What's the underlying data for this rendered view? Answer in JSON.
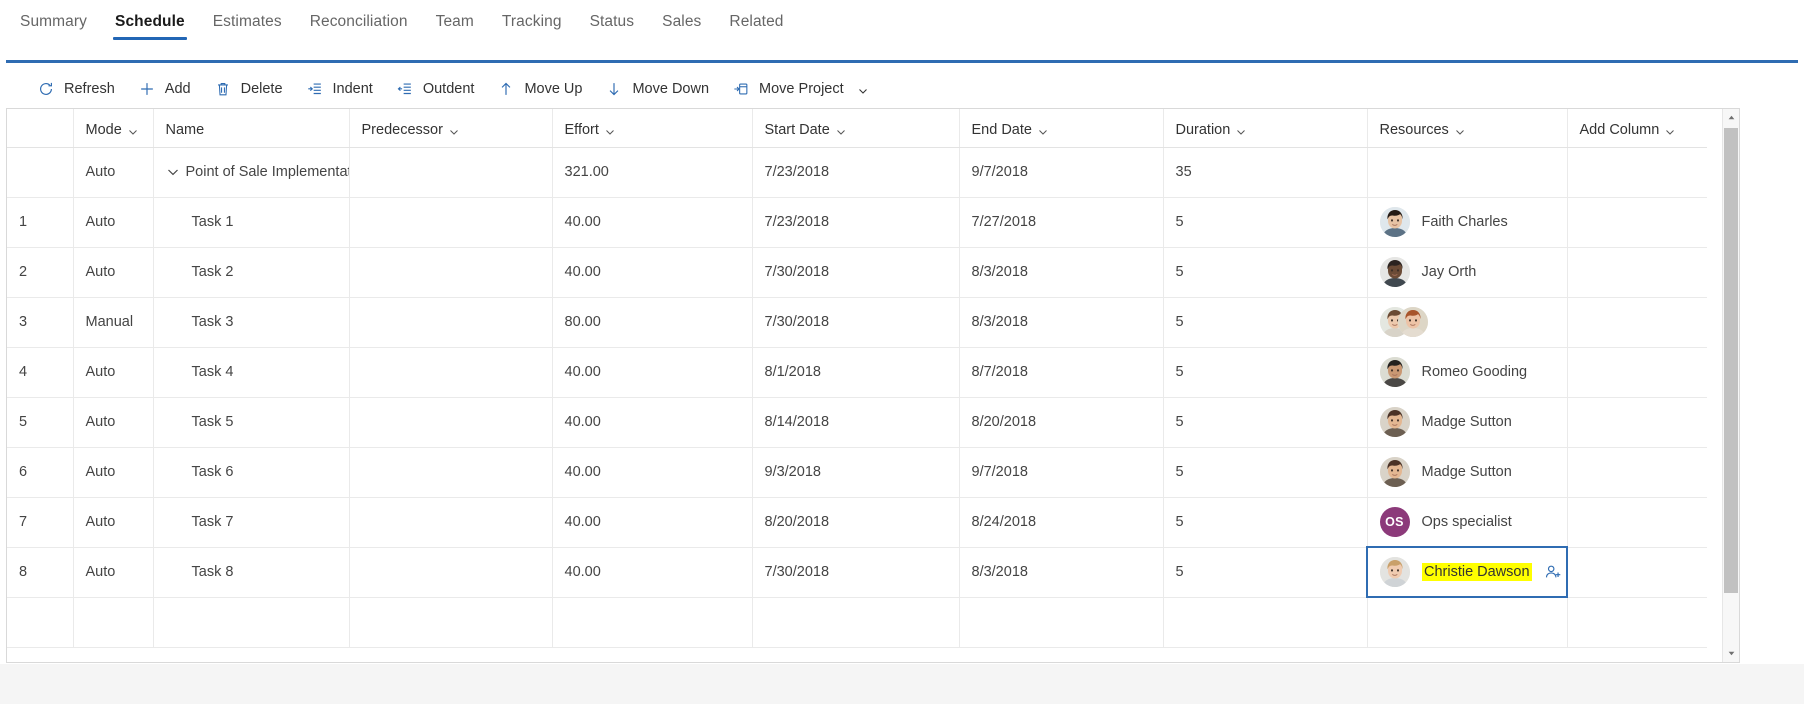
{
  "tabs": [
    {
      "label": "Summary",
      "active": false
    },
    {
      "label": "Schedule",
      "active": true
    },
    {
      "label": "Estimates",
      "active": false
    },
    {
      "label": "Reconciliation",
      "active": false
    },
    {
      "label": "Team",
      "active": false
    },
    {
      "label": "Tracking",
      "active": false
    },
    {
      "label": "Status",
      "active": false
    },
    {
      "label": "Sales",
      "active": false
    },
    {
      "label": "Related",
      "active": false
    }
  ],
  "toolbar": {
    "refresh": "Refresh",
    "add": "Add",
    "delete": "Delete",
    "indent": "Indent",
    "outdent": "Outdent",
    "move_up": "Move Up",
    "move_down": "Move Down",
    "move_project": "Move Project"
  },
  "grid": {
    "headers": {
      "index": "",
      "mode": "Mode",
      "name": "Name",
      "predecessor": "Predecessor",
      "effort": "Effort",
      "start_date": "Start Date",
      "end_date": "End Date",
      "duration": "Duration",
      "resources": "Resources",
      "add_column": "Add Column"
    },
    "rows": [
      {
        "index": "",
        "mode": "Auto",
        "name": "Point of Sale Implementat",
        "is_summary": true,
        "predecessor": "",
        "effort": "321.00",
        "start_date": "7/23/2018",
        "end_date": "9/7/2018",
        "duration": "35",
        "resources": []
      },
      {
        "index": "1",
        "mode": "Auto",
        "name": "Task 1",
        "is_summary": false,
        "predecessor": "",
        "effort": "40.00",
        "start_date": "7/23/2018",
        "end_date": "7/27/2018",
        "duration": "5",
        "resources": [
          {
            "name": "Faith Charles",
            "type": "photo",
            "variant": "woman-asian"
          }
        ]
      },
      {
        "index": "2",
        "mode": "Auto",
        "name": "Task 2",
        "is_summary": false,
        "predecessor": "",
        "effort": "40.00",
        "start_date": "7/30/2018",
        "end_date": "8/3/2018",
        "duration": "5",
        "resources": [
          {
            "name": "Jay Orth",
            "type": "photo",
            "variant": "man-dark"
          }
        ]
      },
      {
        "index": "3",
        "mode": "Manual",
        "name": "Task 3",
        "is_summary": false,
        "predecessor": "",
        "effort": "80.00",
        "start_date": "7/30/2018",
        "end_date": "8/3/2018",
        "duration": "5",
        "resources": [
          {
            "name": "",
            "type": "photo",
            "variant": "woman-light"
          },
          {
            "name": "",
            "type": "photo",
            "variant": "woman-red"
          }
        ]
      },
      {
        "index": "4",
        "mode": "Auto",
        "name": "Task 4",
        "is_summary": false,
        "predecessor": "",
        "effort": "40.00",
        "start_date": "8/1/2018",
        "end_date": "8/7/2018",
        "duration": "5",
        "resources": [
          {
            "name": "Romeo Gooding",
            "type": "photo",
            "variant": "man-suit"
          }
        ]
      },
      {
        "index": "5",
        "mode": "Auto",
        "name": "Task 5",
        "is_summary": false,
        "predecessor": "",
        "effort": "40.00",
        "start_date": "8/14/2018",
        "end_date": "8/20/2018",
        "duration": "5",
        "resources": [
          {
            "name": "Madge Sutton",
            "type": "photo",
            "variant": "woman-brown"
          }
        ]
      },
      {
        "index": "6",
        "mode": "Auto",
        "name": "Task 6",
        "is_summary": false,
        "predecessor": "",
        "effort": "40.00",
        "start_date": "9/3/2018",
        "end_date": "9/7/2018",
        "duration": "5",
        "resources": [
          {
            "name": "Madge Sutton",
            "type": "photo",
            "variant": "woman-brown"
          }
        ]
      },
      {
        "index": "7",
        "mode": "Auto",
        "name": "Task 7",
        "is_summary": false,
        "predecessor": "",
        "effort": "40.00",
        "start_date": "8/20/2018",
        "end_date": "8/24/2018",
        "duration": "5",
        "resources": [
          {
            "name": "Ops specialist",
            "type": "initials",
            "initials": "OS",
            "color": "#8c3a7a"
          }
        ]
      },
      {
        "index": "8",
        "mode": "Auto",
        "name": "Task 8",
        "is_summary": false,
        "predecessor": "",
        "effort": "40.00",
        "start_date": "7/30/2018",
        "end_date": "8/3/2018",
        "duration": "5",
        "selected_cell": "resources",
        "resources": [
          {
            "name": "Christie Dawson",
            "type": "photo",
            "variant": "woman-blonde",
            "highlighted": true
          }
        ]
      }
    ]
  },
  "colors": {
    "accent": "#2f6cb2",
    "tab_underline": "#2266b5",
    "selection_border": "#2f6cb2",
    "text_highlight": "#ffff00",
    "initials_avatar": "#8c3a7a",
    "grid_line": "#eaeaea"
  },
  "scrollbar": {
    "up_arrow": "scroll-up",
    "down_arrow": "scroll-down",
    "orientation": "vertical"
  }
}
